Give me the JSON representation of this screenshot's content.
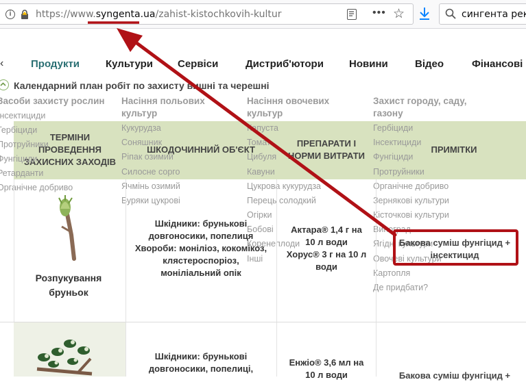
{
  "browser": {
    "url_prefix": "https://www.",
    "url_domain": "syngenta.ua",
    "url_path": "/zahist-kistochkovih-kultur",
    "search_text": "сингента реком"
  },
  "nav": {
    "items": [
      "Продукти",
      "Культури",
      "Сервіси",
      "Дистриб'ютори",
      "Новини",
      "Відео",
      "Фінансові"
    ]
  },
  "breadcrumb": {
    "title": "Календарний план робіт по захисту вишні та черешні"
  },
  "menu": {
    "col1": {
      "header": "Засоби захисту рослин",
      "items": [
        "Інсектициди",
        "Гербіциди",
        "Протруйники",
        "Фунгіциди",
        "Ретарданти",
        "Органічне добриво"
      ]
    },
    "col2": {
      "header_line1": "Насіння польових",
      "header_line2": "культур",
      "items": [
        "Кукурудза",
        "Соняшник",
        "Ріпак озимий",
        "Силосне сорго",
        "Ячмінь озимий",
        "Буряки цукрові"
      ]
    },
    "col3": {
      "header_line1": "Насіння овочевих",
      "header_line2": "культур",
      "items": [
        "Капуста",
        "Томат",
        "Цибуля",
        "Кавуни",
        "Цукрова кукурудза",
        "Перець солодкий",
        "Огірки",
        "Бобові",
        "Коренеплоди",
        "Інші"
      ]
    },
    "col4": {
      "header_line1": "Захист городу, саду,",
      "header_line2": "газону",
      "items": [
        "Гербіциди",
        "Інсектициди",
        "Фунгіциди",
        "Протруйники",
        "Органічне добриво",
        "Зернякові культури",
        "Кісточкові культури",
        "Виноград",
        "Ягідні культури",
        "Овочеві культури",
        "Картопля",
        "Де придбати?"
      ]
    }
  },
  "table": {
    "headers": {
      "terms": [
        "ТЕРМІНИ",
        "ПРОВЕДЕННЯ",
        "ЗАХИСНИХ ЗАХОДІВ"
      ],
      "object": "ШКОДОЧИННИЙ ОБ'ЄКТ",
      "products": [
        "ПРЕПАРАТИ І",
        "НОРМИ ВИТРАТИ"
      ],
      "notes": "ПРИМІТКИ"
    },
    "rows": [
      {
        "stage": [
          "Розпукування",
          "бруньок"
        ],
        "object": [
          "Шкідники: брунькові",
          "довгоносики, попелиця",
          "Хвороби: моніліоз, кокомікоз,",
          "клястероспоріоз,",
          "моніліальний опік"
        ],
        "products": [
          "Актара® 1,4 г на",
          "10 л води",
          "Хорус® 3 г на 10 л",
          "води"
        ],
        "notes": [
          "Бакова суміш фунгіцид +",
          "інсектицид"
        ]
      },
      {
        "stage": [],
        "object": [
          "Шкідники: брунькові",
          "довгоносики, попелиці,"
        ],
        "products": [
          "Енжіо® 3,6 мл на",
          "10 л води"
        ],
        "notes": [
          "Бакова суміш фунгіцид +"
        ]
      }
    ]
  },
  "colors": {
    "accent_nav": "#2a6f73",
    "table_header_bg": "#d8e2bf",
    "annotation_red": "#b01116"
  }
}
